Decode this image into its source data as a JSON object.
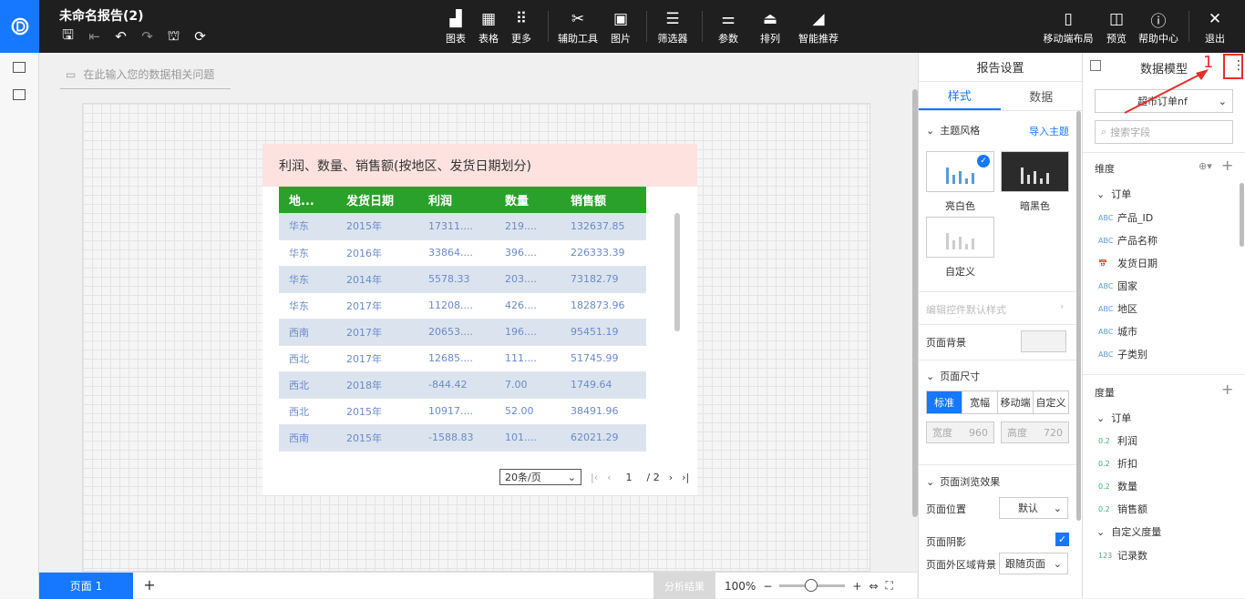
{
  "app": {
    "title": "未命名报告(2)"
  },
  "toolbar": [
    {
      "name": "chart",
      "label": "图表"
    },
    {
      "name": "table",
      "label": "表格"
    },
    {
      "name": "more",
      "label": "更多"
    },
    {
      "name": "aux-tools",
      "label": "辅助工具"
    },
    {
      "name": "image",
      "label": "图片"
    },
    {
      "name": "filter",
      "label": "筛选器"
    },
    {
      "name": "params",
      "label": "参数"
    },
    {
      "name": "arrange",
      "label": "排列"
    },
    {
      "name": "smart-recommend",
      "label": "智能推荐"
    },
    {
      "name": "mobile-layout",
      "label": "移动端布局"
    },
    {
      "name": "preview",
      "label": "预览"
    },
    {
      "name": "help",
      "label": "帮助中心"
    },
    {
      "name": "exit",
      "label": "退出"
    }
  ],
  "ask": {
    "placeholder": "在此输入您的数据相关问题"
  },
  "widget": {
    "title": "利润、数量、销售额(按地区、发货日期划分)",
    "headers": [
      "地...",
      "发货日期",
      "利润",
      "数量",
      "销售额"
    ],
    "rows": [
      [
        "华东",
        "2015年",
        "17311....",
        "219....",
        "132637.85"
      ],
      [
        "华东",
        "2016年",
        "33864....",
        "396....",
        "226333.39"
      ],
      [
        "华东",
        "2014年",
        "5578.33",
        "203....",
        "73182.79"
      ],
      [
        "华东",
        "2017年",
        "11208....",
        "426....",
        "182873.96"
      ],
      [
        "西南",
        "2017年",
        "20653....",
        "196....",
        "95451.19"
      ],
      [
        "西北",
        "2017年",
        "12685....",
        "111....",
        "51745.99"
      ],
      [
        "西北",
        "2018年",
        "-844.42",
        "7.00",
        "1749.64"
      ],
      [
        "西北",
        "2015年",
        "10917....",
        "52.00",
        "38491.96"
      ],
      [
        "西南",
        "2015年",
        "-1588.83",
        "101....",
        "62021.29"
      ]
    ],
    "pager": {
      "page_size": "20条/页",
      "current": "1",
      "total": "/ 2"
    }
  },
  "bottom": {
    "page_tab": "页面 1",
    "add": "+",
    "analysis": "分析结果",
    "zoom": "100%"
  },
  "report_settings": {
    "title": "报告设置",
    "tabs": [
      "样式",
      "数据"
    ],
    "theme_label": "主题风格",
    "import_theme": "导入主题",
    "themes": [
      "亮白色",
      "暗黑色",
      "自定义"
    ],
    "edit_default": "编辑控件默认样式",
    "page_bg": "页面背景",
    "page_size": "页面尺寸",
    "size_options": [
      "标准",
      "宽幅",
      "移动端",
      "自定义"
    ],
    "width_label": "宽度",
    "width_value": "960",
    "height_label": "高度",
    "height_value": "720",
    "browse_effect": "页面浏览效果",
    "page_position": "页面位置",
    "page_position_value": "默认",
    "page_shadow": "页面阴影",
    "outer_bg": "页面外区域背景",
    "outer_bg_value": "跟随页面"
  },
  "data_model": {
    "title": "数据模型",
    "dataset": "超市订单nf",
    "search_placeholder": "搜索字段",
    "dimensions_label": "维度",
    "dim_group": "订单",
    "dimensions": [
      {
        "type": "ABC",
        "name": "产品_ID"
      },
      {
        "type": "ABC",
        "name": "产品名称"
      },
      {
        "type": "date",
        "name": "发货日期"
      },
      {
        "type": "ABC",
        "name": "国家"
      },
      {
        "type": "ABC",
        "name": "地区"
      },
      {
        "type": "ABC",
        "name": "城市"
      },
      {
        "type": "ABC",
        "name": "子类别"
      }
    ],
    "measures_label": "度量",
    "measure_group": "订单",
    "measures": [
      {
        "type": "0.2",
        "name": "利润"
      },
      {
        "type": "0.2",
        "name": "折扣"
      },
      {
        "type": "0.2",
        "name": "数量"
      },
      {
        "type": "0.2",
        "name": "销售额"
      }
    ],
    "custom_group": "自定义度量",
    "custom_measures": [
      {
        "type": "123",
        "name": "记录数"
      }
    ]
  },
  "annotation": {
    "number": "1"
  }
}
